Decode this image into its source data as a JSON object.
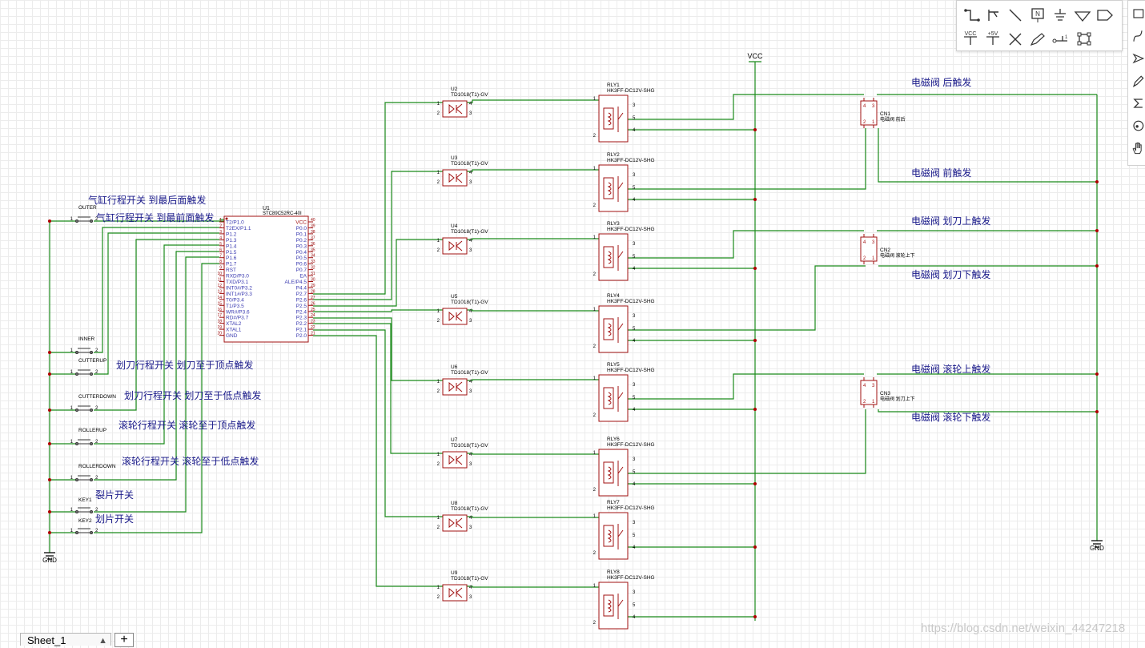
{
  "colors": {
    "wire": "#1a8a1a",
    "part": "#a01010",
    "pin": "#3a3ab0",
    "annot": "#1a1a8a",
    "junction": "#b00000",
    "bg": "#ffffff"
  },
  "toolbar": {
    "icons": [
      "wire-icon",
      "bus-icon",
      "line-icon",
      "netlabel-icon",
      "ground-icon",
      "gnd-triangle-icon",
      "netport-icon",
      "vcc-icon",
      "plus5v-icon",
      "no-connect-icon",
      "pen-icon",
      "pin-icon",
      "group-icon"
    ],
    "vcc_label": "VCC",
    "plus5v_label": "+5V"
  },
  "side_toolbar": {
    "icons": [
      "rect-icon",
      "curve-icon",
      "arrow-icon",
      "pencil-icon",
      "sigma-icon",
      "circle-icon",
      "hand-icon"
    ]
  },
  "power": {
    "vcc": "VCC",
    "gnd_left": "GND",
    "gnd_right": "GND"
  },
  "mcu": {
    "ref": "U1",
    "value": "STC89C52RC-40I",
    "left_pins": [
      "T2/P1.0",
      "T2EX/P1.1",
      "P1.2",
      "P1.3",
      "P1.4",
      "P1.5",
      "P1.6",
      "P1.7",
      "RST",
      "RXD/P3.0",
      "TXD/P3.1",
      "INT0#/P3.2",
      "INT1#/P3.3",
      "T0/P3.4",
      "T1/P3.5",
      "WR#/P3.6",
      "RD#/P3.7",
      "XTAL2",
      "XTAL1",
      "GND"
    ],
    "left_nums": [
      "1",
      "2",
      "3",
      "4",
      "5",
      "6",
      "7",
      "8",
      "9",
      "10",
      "11",
      "12",
      "13",
      "14",
      "15",
      "16",
      "17",
      "18",
      "19",
      "20"
    ],
    "right_pins": [
      "VCC",
      "P0.0",
      "P0.1",
      "P0.2",
      "P0.3",
      "P0.4",
      "P0.5",
      "P0.6",
      "P0.7",
      "EA",
      "ALE/P4.5",
      "P4.4",
      "P2.7",
      "P2.6",
      "P2.5",
      "P2.4",
      "P2.3",
      "P2.2",
      "P2.1",
      "P2.0"
    ],
    "right_nums": [
      "40",
      "39",
      "38",
      "37",
      "36",
      "35",
      "34",
      "33",
      "32",
      "31",
      "30",
      "29",
      "28",
      "27",
      "26",
      "25",
      "24",
      "23",
      "22",
      "21"
    ]
  },
  "switches": [
    {
      "ref": "OUTER",
      "annot": "气缸行程开关 到最后面触发"
    },
    {
      "ref": "INNER",
      "annot": "气缸行程开关 到最前面触发"
    },
    {
      "ref": "CUTTERUP",
      "annot": "划刀行程开关 划刀至于顶点触发"
    },
    {
      "ref": "CUTTERDOWN",
      "annot": "划刀行程开关 划刀至于低点触发"
    },
    {
      "ref": "ROLLERUP",
      "annot": "滚轮行程开关 滚轮至于顶点触发"
    },
    {
      "ref": "ROLLERDOWN",
      "annot": "滚轮行程开关 滚轮至于低点触发"
    },
    {
      "ref": "KEY1",
      "annot": "裂片开关"
    },
    {
      "ref": "KEY2",
      "annot": "划片开关"
    }
  ],
  "switch_pins": [
    "1",
    "2"
  ],
  "optos": [
    {
      "ref": "U2"
    },
    {
      "ref": "U3"
    },
    {
      "ref": "U4"
    },
    {
      "ref": "U5"
    },
    {
      "ref": "U6"
    },
    {
      "ref": "U7"
    },
    {
      "ref": "U8"
    },
    {
      "ref": "U9"
    }
  ],
  "opto_value": "TD1018(T1)-GV",
  "opto_pins": [
    "1",
    "2",
    "4",
    "3"
  ],
  "relays": [
    {
      "ref": "RLY1"
    },
    {
      "ref": "RLY2"
    },
    {
      "ref": "RLY3"
    },
    {
      "ref": "RLY4"
    },
    {
      "ref": "RLY5"
    },
    {
      "ref": "RLY6"
    },
    {
      "ref": "RLY7"
    },
    {
      "ref": "RLY8"
    }
  ],
  "relay_value": "HK3FF-DC12V-SHG",
  "relay_pins": [
    "1",
    "2",
    "3",
    "5",
    "4"
  ],
  "connectors": [
    {
      "ref": "CN1",
      "desc": "电磁阀 前后"
    },
    {
      "ref": "CN2",
      "desc": "电磁阀 滚轮上下"
    },
    {
      "ref": "CN3",
      "desc": "电磁阀 划刀上下"
    }
  ],
  "conn_pins": [
    "4",
    "3",
    "2",
    "1"
  ],
  "valve_labels": [
    "电磁阀 后触发",
    "电磁阀 前触发",
    "电磁阀 划刀上触发",
    "电磁阀 划刀下触发",
    "电磁阀 滚轮上触发",
    "电磁阀 滚轮下触发"
  ],
  "sheet": {
    "tab": "Sheet_1",
    "arrow": "▲",
    "add": "+"
  },
  "watermark": "https://blog.csdn.net/weixin_44247218"
}
